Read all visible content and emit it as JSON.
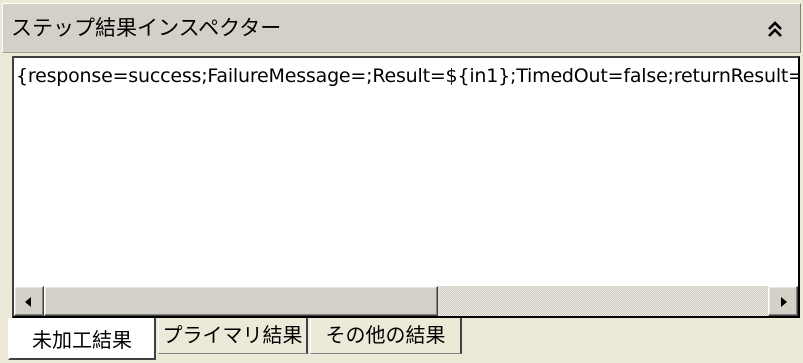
{
  "panel": {
    "title": "ステップ結果インスペクター",
    "collapse_icon": "double-chevron-up-icon"
  },
  "content": {
    "result_text": "{response=success;FailureMessage=;Result=${in1};TimedOut=false;returnResult="
  },
  "scrollbar": {
    "left_icon": "arrow-left-icon",
    "right_icon": "arrow-right-icon"
  },
  "tabs": [
    {
      "label": "未加工結果",
      "active": true
    },
    {
      "label": "プライマリ結果",
      "active": false
    },
    {
      "label": "その他の結果",
      "active": false
    }
  ]
}
